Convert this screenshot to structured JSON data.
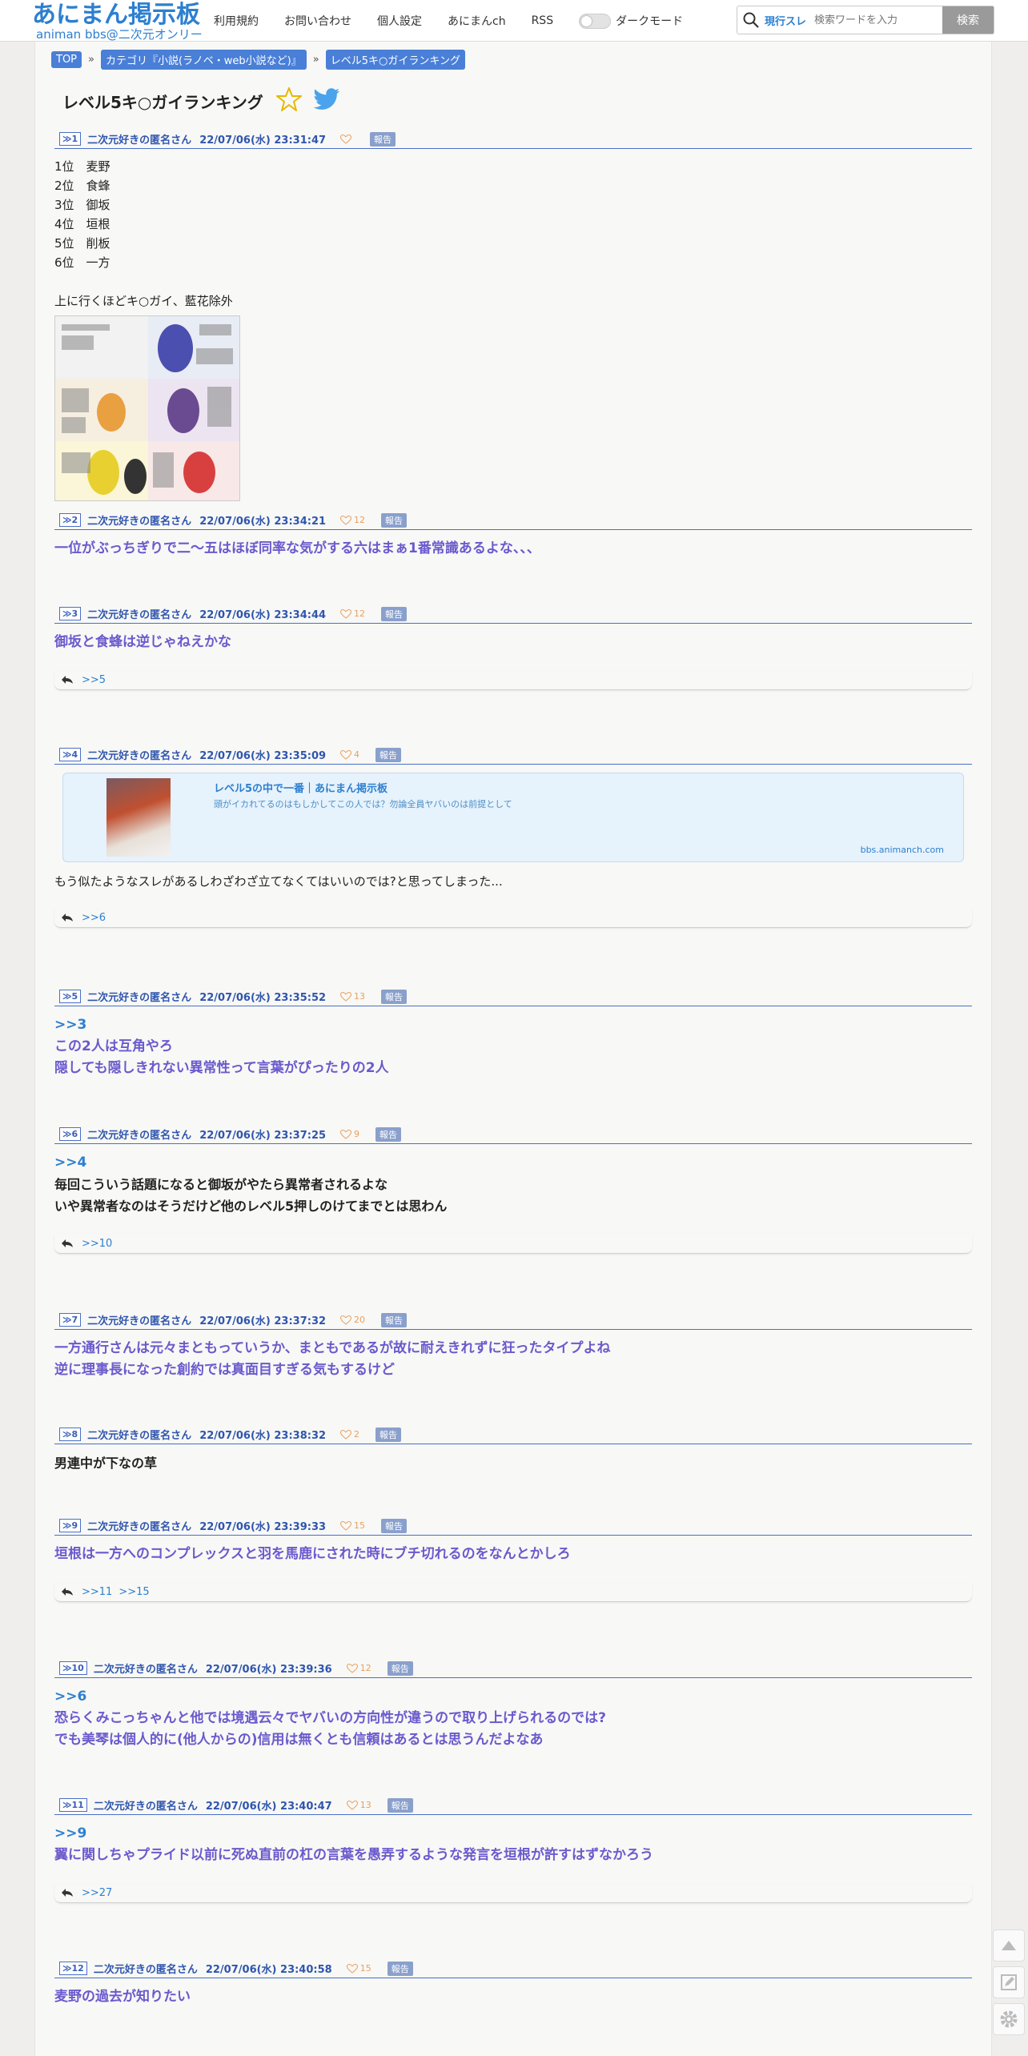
{
  "header": {
    "logo_main": "あにまん掲示板",
    "logo_sub": "animan bbs@二次元オンリー",
    "nav": [
      "利用規約",
      "お問い合わせ",
      "個人設定",
      "あにまんch",
      "RSS"
    ],
    "dark_mode_label": "ダークモード",
    "search_scope": "現行スレ",
    "search_placeholder": "検索ワードを入力",
    "search_button": "検索"
  },
  "breadcrumb": [
    "TOP",
    "カテゴリ『小説(ラノベ・web小説など)』",
    "レベル5キ○ガイランキング"
  ],
  "thread_title": "レベル5キ○ガイランキング",
  "posts": [
    {
      "no": "≫1",
      "name": "二次元好きの匿名さん",
      "date": "22/07/06(水) 23:31:47",
      "likes": "",
      "report": "報告",
      "lines": [
        "1位　麦野",
        "2位　食蜂",
        "3位　御坂",
        "4位　垣根",
        "5位　削板",
        "6位　一方"
      ],
      "extra": "上に行くほどキ○ガイ、藍花除外"
    },
    {
      "no": "≫2",
      "name": "二次元好きの匿名さん",
      "date": "22/07/06(水) 23:34:21",
      "likes": "12",
      "report": "報告",
      "text": "一位がぶっちぎりで二〜五はほぼ同率な気がする六はまぁ1番常識あるよな、、、"
    },
    {
      "no": "≫3",
      "name": "二次元好きの匿名さん",
      "date": "22/07/06(水) 23:34:44",
      "likes": "12",
      "report": "報告",
      "text": "御坂と食蜂は逆じゃねえかな",
      "replies": [
        ">>5"
      ]
    },
    {
      "no": "≫4",
      "name": "二次元好きの匿名さん",
      "date": "22/07/06(水) 23:35:09",
      "likes": "4",
      "report": "報告",
      "card_title": "レベル5の中で一番｜あにまん掲示板",
      "card_desc": "頭がイカれてるのはもしかしてこの人では？勿論全員ヤバいのは前提として",
      "card_domain": "bbs.animanch.com",
      "text": "もう似たようなスレがあるしわざわざ立てなくてはいいのでは?と思ってしまった...",
      "replies": [
        ">>6"
      ]
    },
    {
      "no": "≫5",
      "name": "二次元好きの匿名さん",
      "date": "22/07/06(水) 23:35:52",
      "likes": "13",
      "report": "報告",
      "anchor": ">>3",
      "lines": [
        "この2人は互角やろ",
        "隠しても隠しきれない異常性って言葉がぴったりの2人"
      ]
    },
    {
      "no": "≫6",
      "name": "二次元好きの匿名さん",
      "date": "22/07/06(水) 23:37:25",
      "likes": "9",
      "report": "報告",
      "anchor": ">>4",
      "lines": [
        "毎回こういう話題になると御坂がやたら異常者されるよな",
        "いや異常者なのはそうだけど他のレベル5押しのけてまでとは思わん"
      ],
      "replies": [
        ">>10"
      ]
    },
    {
      "no": "≫7",
      "name": "二次元好きの匿名さん",
      "date": "22/07/06(水) 23:37:32",
      "likes": "20",
      "report": "報告",
      "lines": [
        "一方通行さんは元々まともっていうか、まともであるが故に耐えきれずに狂ったタイプよね",
        "逆に理事長になった創約では真面目すぎる気もするけど"
      ]
    },
    {
      "no": "≫8",
      "name": "二次元好きの匿名さん",
      "date": "22/07/06(水) 23:38:32",
      "likes": "2",
      "report": "報告",
      "text": "男連中が下なの草"
    },
    {
      "no": "≫9",
      "name": "二次元好きの匿名さん",
      "date": "22/07/06(水) 23:39:33",
      "likes": "15",
      "report": "報告",
      "text": "垣根は一方へのコンプレックスと羽を馬鹿にされた時にブチ切れるのをなんとかしろ",
      "replies": [
        ">>11",
        ">>15"
      ]
    },
    {
      "no": "≫10",
      "name": "二次元好きの匿名さん",
      "date": "22/07/06(水) 23:39:36",
      "likes": "12",
      "report": "報告",
      "anchor": ">>6",
      "lines": [
        "恐らくみこっちゃんと他では境遇云々でヤバいの方向性が違うので取り上げられるのでは?",
        "でも美琴は個人的に(他人からの)信用は無くとも信頼はあるとは思うんだよなあ"
      ]
    },
    {
      "no": "≫11",
      "name": "二次元好きの匿名さん",
      "date": "22/07/06(水) 23:40:47",
      "likes": "13",
      "report": "報告",
      "anchor": ">>9",
      "text": "翼に関しちゃプライド以前に死ぬ直前の杠の言葉を愚弄するような発言を垣根が許すはずなかろう",
      "replies": [
        ">>27"
      ]
    },
    {
      "no": "≫12",
      "name": "二次元好きの匿名さん",
      "date": "22/07/06(水) 23:40:58",
      "likes": "15",
      "report": "報告",
      "text": "麦野の過去が知りたい"
    }
  ],
  "colors": {
    "accent_blue": "#2d7fd0",
    "post_header_blue": "#2f55ae",
    "body_purple": "#6a5acd",
    "report_badge": "#8aa0cc",
    "like_orange": "#e8a060"
  }
}
